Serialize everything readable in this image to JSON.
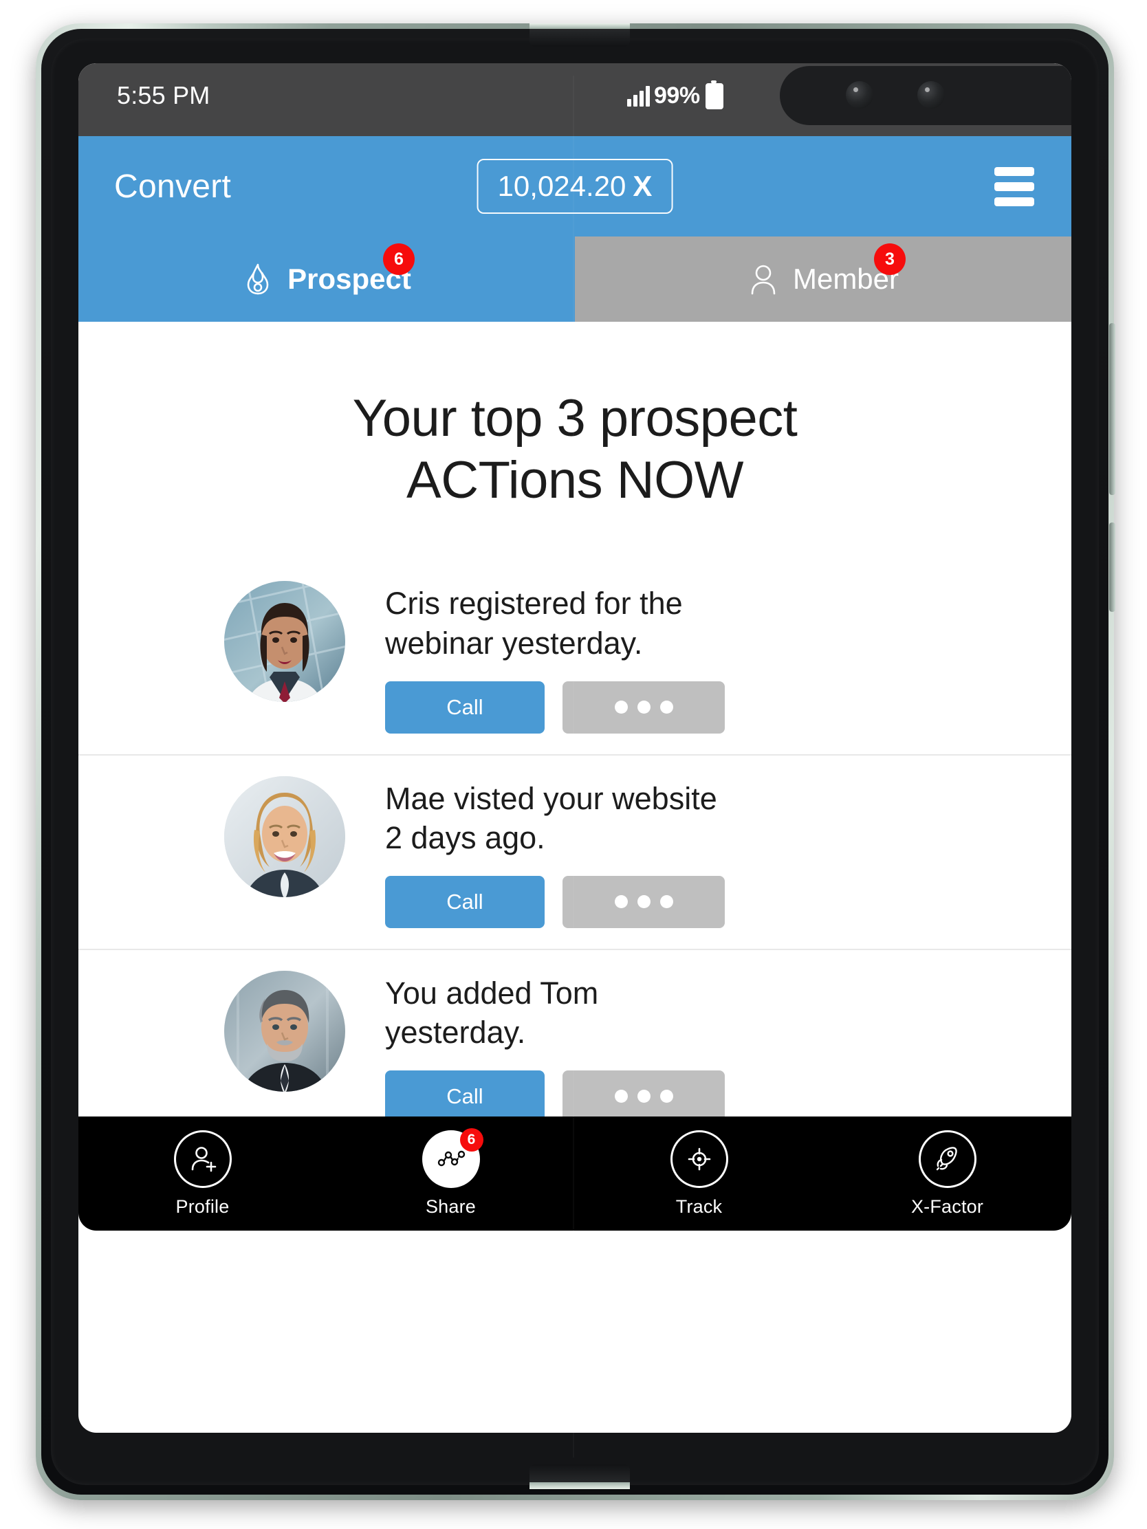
{
  "status_bar": {
    "time": "5:55 PM",
    "battery_percent": "99%",
    "signal_icon": "signal-bars-icon",
    "battery_icon": "battery-full-icon"
  },
  "header": {
    "brand": "Convert",
    "balance_amount": "10,024.20",
    "balance_currency": "X",
    "menu_icon": "hamburger-menu-icon",
    "background_color": "#4a9ad4"
  },
  "tabs": [
    {
      "label": "Prospect",
      "badge": "6",
      "icon": "flame-icon",
      "active": true,
      "background_color": "#4a9ad4"
    },
    {
      "label": "Member",
      "badge": "3",
      "icon": "person-icon",
      "active": false,
      "background_color": "#a8a8a8"
    }
  ],
  "main": {
    "title": "Your top 3 prospect\nACTions NOW",
    "actions": [
      {
        "avatar_name": "avatar-cris",
        "text": "Cris registered for the\nwebinar yesterday.",
        "call_label": "Call",
        "more_icon": "ellipsis-icon"
      },
      {
        "avatar_name": "avatar-mae",
        "text": "Mae visted your website\n2 days ago.",
        "call_label": "Call",
        "more_icon": "ellipsis-icon"
      },
      {
        "avatar_name": "avatar-tom",
        "text": "You added Tom\nyesterday.",
        "call_label": "Call",
        "more_icon": "ellipsis-icon"
      }
    ]
  },
  "bottom_nav": [
    {
      "label": "Profile",
      "icon": "add-user-icon",
      "badge": "",
      "filled": false
    },
    {
      "label": "Share",
      "icon": "share-network-icon",
      "badge": "6",
      "filled": true
    },
    {
      "label": "Track",
      "icon": "target-crosshair-icon",
      "badge": "",
      "filled": false
    },
    {
      "label": "X-Factor",
      "icon": "rocket-icon",
      "badge": "",
      "filled": false
    }
  ],
  "colors": {
    "accent_blue": "#4a9ad4",
    "inactive_gray": "#a8a8a8",
    "badge_red": "#f60c0c",
    "button_gray": "#bfbfbf",
    "nav_black": "#000000",
    "status_bar_gray": "#454546"
  }
}
